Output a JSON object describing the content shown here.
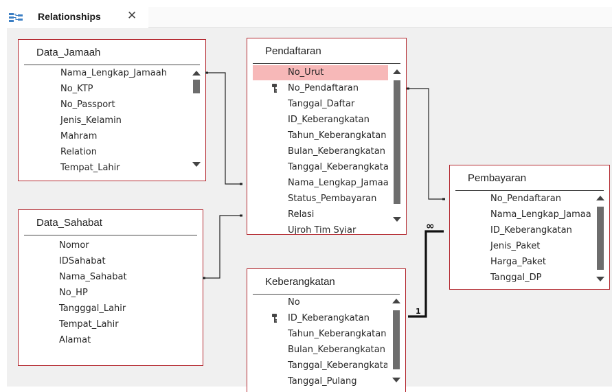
{
  "tab": {
    "label": "Relationships",
    "close": "✕"
  },
  "tables": {
    "jamaah": {
      "title": "Data_Jamaah",
      "fields": [
        "Nama_Lengkap_Jamaah",
        "No_KTP",
        "No_Passport",
        "Jenis_Kelamin",
        "Mahram",
        "Relation",
        "Tempat_Lahir"
      ]
    },
    "sahabat": {
      "title": "Data_Sahabat",
      "fields": [
        "Nomor",
        "IDSahabat",
        "Nama_Sahabat",
        "No_HP",
        "Tangggal_Lahir",
        "Tempat_Lahir",
        "Alamat"
      ]
    },
    "pendaftaran": {
      "title": "Pendaftaran",
      "fields": [
        "No_Urut",
        "No_Pendaftaran",
        "Tanggal_Daftar",
        "ID_Keberangkatan",
        "Tahun_Keberangkatan",
        "Bulan_Keberangkatan",
        "Tanggal_Keberangkatan",
        "Nama_Lengkap_Jamaah",
        "Status_Pembayaran",
        "Relasi",
        "Ujroh Tim Syiar"
      ]
    },
    "keberangkatan": {
      "title": "Keberangkatan",
      "fields": [
        "No",
        "ID_Keberangkatan",
        "Tahun_Keberangkatan",
        "Bulan_Keberangkatan",
        "Tanggal_Keberangkatan",
        "Tanggal_Pulang"
      ]
    },
    "pembayaran": {
      "title": "Pembayaran",
      "fields": [
        "No_Pendaftaran",
        "Nama_Lengkap_Jamaah",
        "ID_Keberangkatan",
        "Jenis_Paket",
        "Harga_Paket",
        "Tanggal_DP"
      ]
    }
  },
  "relationship": {
    "one": "1",
    "many": "∞"
  },
  "colors": {
    "table_border": "#b3272e",
    "selected_field": "#f7b8b8",
    "canvas": "#f0f0f0"
  },
  "icons": {
    "tab": "relationships-icon",
    "key": "primary-key-icon"
  }
}
